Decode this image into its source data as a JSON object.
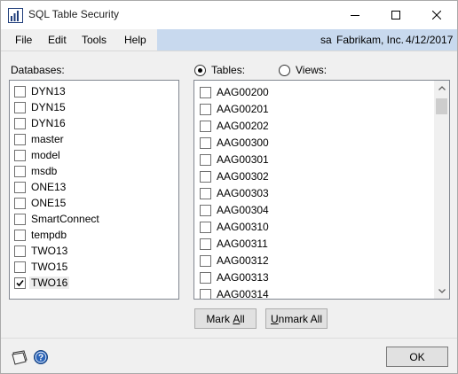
{
  "window": {
    "title": "SQL Table Security"
  },
  "menu": {
    "items": [
      "File",
      "Edit",
      "Tools",
      "Help"
    ],
    "user_id": "sa",
    "company": "Fabrikam, Inc.",
    "user_date": "4/12/2017"
  },
  "databases": {
    "label": "Databases:",
    "items": [
      {
        "name": "DYN13",
        "checked": false
      },
      {
        "name": "DYN15",
        "checked": false
      },
      {
        "name": "DYN16",
        "checked": false
      },
      {
        "name": "master",
        "checked": false
      },
      {
        "name": "model",
        "checked": false
      },
      {
        "name": "msdb",
        "checked": false
      },
      {
        "name": "ONE13",
        "checked": false
      },
      {
        "name": "ONE15",
        "checked": false
      },
      {
        "name": "SmartConnect",
        "checked": false
      },
      {
        "name": "tempdb",
        "checked": false
      },
      {
        "name": "TWO13",
        "checked": false
      },
      {
        "name": "TWO15",
        "checked": false
      },
      {
        "name": "TWO16",
        "checked": true
      }
    ]
  },
  "view_options": {
    "tables_label": "Tables:",
    "views_label": "Views:",
    "selected": "tables"
  },
  "tables": {
    "items": [
      "AAG00200",
      "AAG00201",
      "AAG00202",
      "AAG00300",
      "AAG00301",
      "AAG00302",
      "AAG00303",
      "AAG00304",
      "AAG00310",
      "AAG00311",
      "AAG00312",
      "AAG00313",
      "AAG00314"
    ]
  },
  "buttons": {
    "mark_all_prefix": "Mark ",
    "mark_all_underlined": "A",
    "mark_all_suffix": "ll",
    "unmark_all_prefix": "",
    "unmark_all_underlined": "U",
    "unmark_all_suffix": "nmark All",
    "ok": "OK"
  }
}
